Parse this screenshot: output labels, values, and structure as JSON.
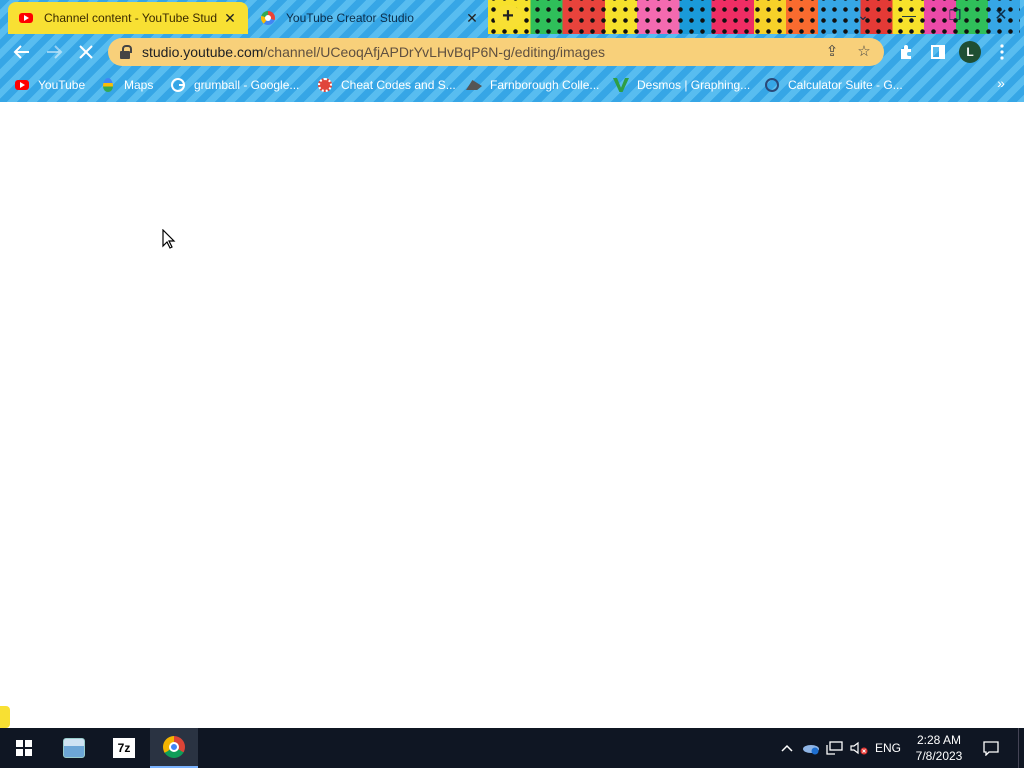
{
  "browser": {
    "tabs": [
      {
        "title": "Channel content - YouTube Stud",
        "active": true,
        "favicon": "youtube-icon"
      },
      {
        "title": "YouTube Creator Studio",
        "active": false,
        "favicon": "youtube-studio-icon"
      }
    ],
    "new_tab_label": "+",
    "window_controls": {
      "minimize": "—",
      "restore": "❐",
      "close": "✕",
      "tab_search": "⌄"
    },
    "address": {
      "host": "studio.youtube.com",
      "path": "/channel/UCeoqAfjAPDrYvLHvBqP6N-g/editing/images"
    },
    "profile_initial": "L",
    "bookmarks": [
      {
        "label": "YouTube",
        "icon": "youtube-icon"
      },
      {
        "label": "Maps",
        "icon": "maps-icon"
      },
      {
        "label": "grumball - Google...",
        "icon": "google-icon"
      },
      {
        "label": "Cheat Codes and S...",
        "icon": "cheat-codes-icon"
      },
      {
        "label": "Farnborough Colle...",
        "icon": "farnborough-icon"
      },
      {
        "label": "Desmos | Graphing...",
        "icon": "desmos-icon"
      },
      {
        "label": "Calculator Suite - G...",
        "icon": "calculator-icon"
      }
    ],
    "bookmarks_overflow": "»"
  },
  "taskbar": {
    "language": "ENG",
    "time": "2:28 AM",
    "date": "7/8/2023",
    "apps": [
      "start-button",
      "file-explorer",
      "7-zip",
      "google-chrome"
    ]
  },
  "colors": {
    "theme_blue": "#36a6e6",
    "active_tab": "#f8e033",
    "omnibox": "#f8d07a",
    "taskbar": "#0f1623"
  }
}
